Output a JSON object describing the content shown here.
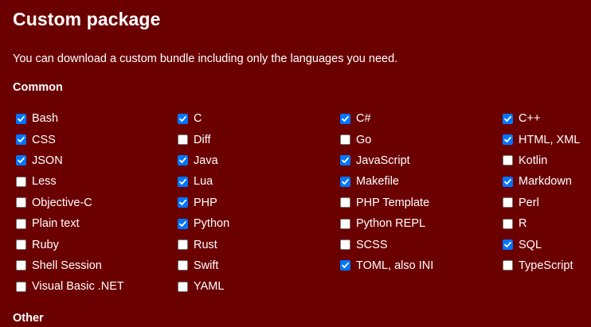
{
  "page": {
    "title": "Custom package",
    "description": "You can download a custom bundle including only the languages you need."
  },
  "sections": {
    "common_title": "Common",
    "other_title": "Other"
  },
  "colors": {
    "background": "#6b0000",
    "checkbox_checked": "#0075ff",
    "text": "#ffffff"
  },
  "common_languages": [
    {
      "label": "Bash",
      "checked": true
    },
    {
      "label": "C",
      "checked": true
    },
    {
      "label": "C#",
      "checked": true
    },
    {
      "label": "C++",
      "checked": true
    },
    {
      "label": "CSS",
      "checked": true
    },
    {
      "label": "Diff",
      "checked": false
    },
    {
      "label": "Go",
      "checked": false
    },
    {
      "label": "HTML, XML",
      "checked": true
    },
    {
      "label": "JSON",
      "checked": true
    },
    {
      "label": "Java",
      "checked": true
    },
    {
      "label": "JavaScript",
      "checked": true
    },
    {
      "label": "Kotlin",
      "checked": false
    },
    {
      "label": "Less",
      "checked": false
    },
    {
      "label": "Lua",
      "checked": true
    },
    {
      "label": "Makefile",
      "checked": true
    },
    {
      "label": "Markdown",
      "checked": true
    },
    {
      "label": "Objective-C",
      "checked": false
    },
    {
      "label": "PHP",
      "checked": true
    },
    {
      "label": "PHP Template",
      "checked": false
    },
    {
      "label": "Perl",
      "checked": false
    },
    {
      "label": "Plain text",
      "checked": false
    },
    {
      "label": "Python",
      "checked": true
    },
    {
      "label": "Python REPL",
      "checked": false
    },
    {
      "label": "R",
      "checked": false
    },
    {
      "label": "Ruby",
      "checked": false
    },
    {
      "label": "Rust",
      "checked": false
    },
    {
      "label": "SCSS",
      "checked": false
    },
    {
      "label": "SQL",
      "checked": true
    },
    {
      "label": "Shell Session",
      "checked": false
    },
    {
      "label": "Swift",
      "checked": false
    },
    {
      "label": "TOML, also INI",
      "checked": true
    },
    {
      "label": "TypeScript",
      "checked": false
    },
    {
      "label": "Visual Basic .NET",
      "checked": false
    },
    {
      "label": "YAML",
      "checked": false
    }
  ]
}
